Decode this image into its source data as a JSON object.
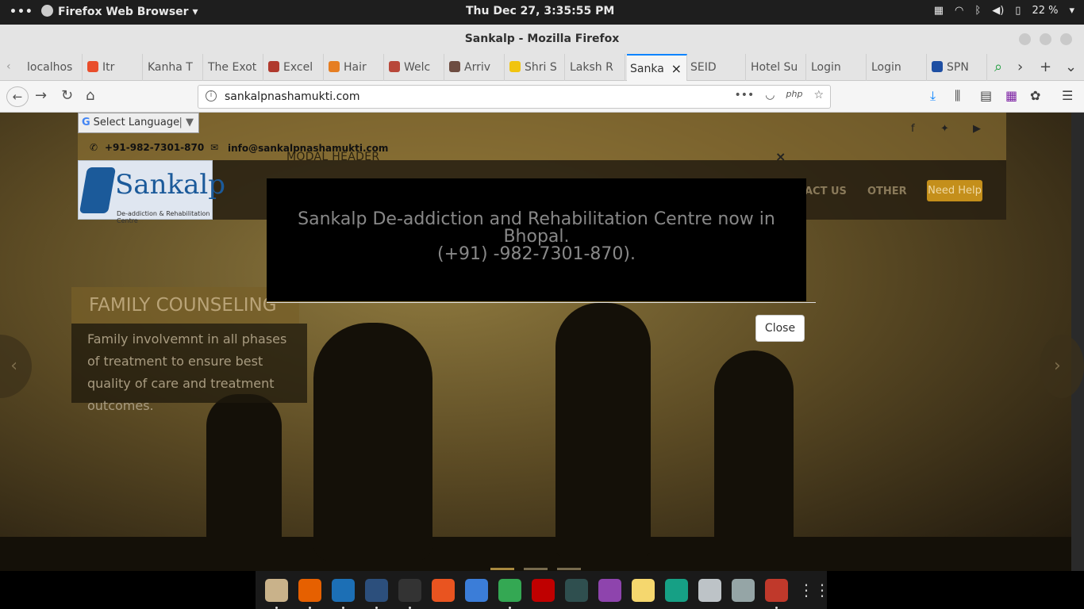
{
  "system_bar": {
    "activities": "•••",
    "app_menu": "Firefox Web Browser ▾",
    "clock": "Thu Dec 27,  3:35:55 PM",
    "battery": "22 %"
  },
  "window": {
    "title": "Sankalp - Mozilla Firefox"
  },
  "tabs": [
    {
      "label": "localhos",
      "color": "#888888"
    },
    {
      "label": "Itr",
      "color": "#e94e2c"
    },
    {
      "label": "Kanha T",
      "color": "#999999"
    },
    {
      "label": "The Exot",
      "color": "#999999"
    },
    {
      "label": "Excel",
      "color": "#b03a2e"
    },
    {
      "label": "Hair",
      "color": "#e67e22"
    },
    {
      "label": "Welc",
      "color": "#b8473a"
    },
    {
      "label": "Arriv",
      "color": "#6d4c41"
    },
    {
      "label": "Shri S",
      "color": "#f1c40f"
    },
    {
      "label": "Laksh R",
      "color": "#999999"
    },
    {
      "label": "Sanka",
      "color": "#999999"
    },
    {
      "label": "SEID",
      "color": "#999999"
    },
    {
      "label": "Hotel Su",
      "color": "#999999"
    },
    {
      "label": "Login",
      "color": "#999999"
    },
    {
      "label": "Login",
      "color": "#999999"
    },
    {
      "label": "SPN",
      "color": "#1e4fa3"
    }
  ],
  "navbar": {
    "url": "sankalpnashamukti.com",
    "more": "•••",
    "php_badge": "php"
  },
  "page": {
    "language_select": "Select Language",
    "phone": "+91-982-7301-870",
    "email": "info@sankalpnashamukti.com",
    "logo_name": "Sankalp",
    "logo_sub": "De-addiction & Rehabilitation Centre",
    "menu": [
      "ACT US",
      "OTHER"
    ],
    "need_help": "Need Help",
    "slide_title": "FAMILY COUNSELING",
    "slide_text": "Family involvemnt in all phases of treatment to ensure best quality of care and treatment outcomes."
  },
  "modal": {
    "header": "MODAL HEADER",
    "close_x": "×",
    "body_line1": "Sankalp De-addiction and Rehabilitation Centre now in",
    "body_line2": "Bhopal.",
    "body_line3": "(+91) -982-7301-870).",
    "close_button": "Close"
  },
  "dock_icons": [
    {
      "name": "files",
      "color": "#c9b28a",
      "running": true
    },
    {
      "name": "firefox",
      "color": "#e66000",
      "running": true
    },
    {
      "name": "vscode",
      "color": "#1c6fb5",
      "running": true
    },
    {
      "name": "mysql-workbench",
      "color": "#2c4f7c",
      "running": true
    },
    {
      "name": "terminal",
      "color": "#333333",
      "running": true
    },
    {
      "name": "software-center",
      "color": "#e95420",
      "running": false
    },
    {
      "name": "document-viewer",
      "color": "#3b7dd8",
      "running": false
    },
    {
      "name": "chrome",
      "color": "#34a853",
      "running": true
    },
    {
      "name": "filezilla",
      "color": "#bf0000",
      "running": false
    },
    {
      "name": "system-monitor",
      "color": "#2f4f4f",
      "running": false
    },
    {
      "name": "vpn",
      "color": "#8e44ad",
      "running": false
    },
    {
      "name": "app-yellow",
      "color": "#f5d76e",
      "running": false
    },
    {
      "name": "app-green",
      "color": "#16a085",
      "running": false
    },
    {
      "name": "app-gray",
      "color": "#bdc3c7",
      "running": false
    },
    {
      "name": "editor",
      "color": "#95a5a6",
      "running": false
    },
    {
      "name": "settings",
      "color": "#c0392b",
      "running": true
    }
  ]
}
